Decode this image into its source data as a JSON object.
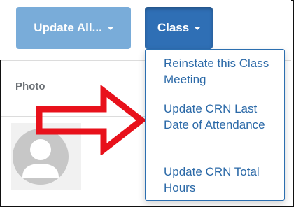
{
  "toolbar": {
    "update_all_label": "Update All...",
    "class_label": "Class"
  },
  "table": {
    "photo_header": "Photo"
  },
  "class_menu": {
    "items": [
      {
        "label": "Reinstate this Class Meeting"
      },
      {
        "label": "Update CRN Last Date of Attendance"
      },
      {
        "label": "Update CRN Total Hours"
      }
    ]
  },
  "colors": {
    "update_all_button": "#79acd9",
    "class_button": "#2f6fb5",
    "menu_link": "#2c6aa8",
    "callout_arrow": "#e8111b"
  }
}
